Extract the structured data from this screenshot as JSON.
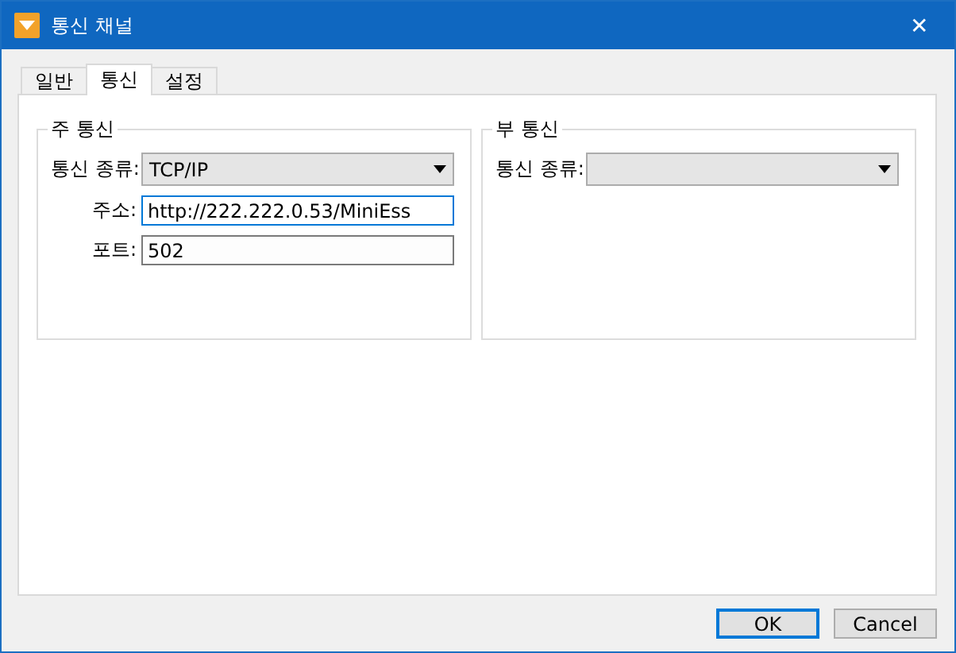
{
  "window": {
    "title": "통신 채널",
    "close": "✕"
  },
  "tabs": [
    {
      "label": "일반",
      "selected": false
    },
    {
      "label": "통신",
      "selected": true
    },
    {
      "label": "설정",
      "selected": false
    }
  ],
  "groups": [
    {
      "title": "주 통신",
      "fields": [
        {
          "kind": "dropdown",
          "label": "통신 종류:",
          "value": "TCP/IP"
        },
        {
          "kind": "text",
          "label": "주소:",
          "value": "http://222.222.0.53/MiniEss",
          "focused": true
        },
        {
          "kind": "text",
          "label": "포트:",
          "value": "502",
          "focused": false
        }
      ]
    },
    {
      "title": "부 통신",
      "fields": [
        {
          "kind": "dropdown",
          "label": "통신 종류:"
        }
      ]
    }
  ],
  "buttons": [
    {
      "label": "OK",
      "default": true
    },
    {
      "label": "Cancel",
      "default": false
    }
  ]
}
